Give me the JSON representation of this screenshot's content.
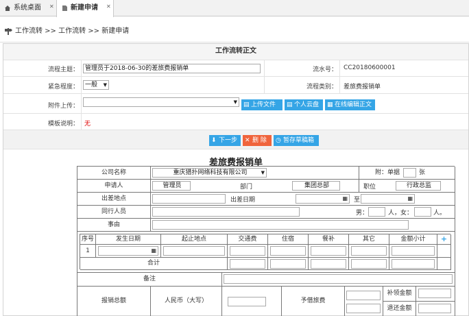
{
  "tabs": [
    {
      "label": "系统桌面"
    },
    {
      "label": "新建申请"
    }
  ],
  "breadcrumb": "工作流转 >> 工作流转 >> 新建申请",
  "form": {
    "title": "工作流转正文",
    "subject_label": "流程主题：",
    "subject_value": "管理员于2018-06-30的差旅费报销单",
    "serial_label": "流水号：",
    "serial_value": "CC20180600001",
    "urgency_label": "紧急程度：",
    "urgency_value": "一般",
    "category_label": "流程类别：",
    "category_value": "差旅费报销单",
    "attach_label": "附件上传：",
    "btn_upload": "上传文件",
    "btn_cloud": "个人云盘",
    "btn_online": "在线编辑正文",
    "template_label": "模板说明：",
    "template_value": "无"
  },
  "actions": {
    "next": "下一步",
    "delete": "删 除",
    "draft": "暂存草稿箱"
  },
  "sheet": {
    "title": "差旅费报销单",
    "company_label": "公司名称",
    "company_value": "重庆猎扑网络科技有限公司",
    "attach_count_label": "附：单据",
    "attach_count_unit": "张",
    "applicant_label": "申请人",
    "applicant_value": "管理员",
    "dept_label": "部门",
    "dept_value": "集团总部",
    "position_label": "职位",
    "position_value": "行政总监",
    "place_label": "出差地点",
    "date_label": "出差日期",
    "to_label": "至",
    "companion_label": "同行人员",
    "male_label": "男：",
    "female_label": "人，女：",
    "person_unit": "人。",
    "reason_label": "事由",
    "cols": [
      "序号",
      "发生日期",
      "起止地点",
      "交通费",
      "住宿",
      "餐补",
      "其它",
      "金额小计"
    ],
    "row_no": "1",
    "total_label": "合计",
    "remark_label": "备注",
    "total_amount_label": "报销总额",
    "rmb_label": "人民币（大写）",
    "advance_label": "予借旅费",
    "refund_label": "补领金额",
    "return_label": "退还金额"
  },
  "colors": {
    "accent": "#35a5e6",
    "delete": "#f0643c",
    "required": "#e00000"
  }
}
